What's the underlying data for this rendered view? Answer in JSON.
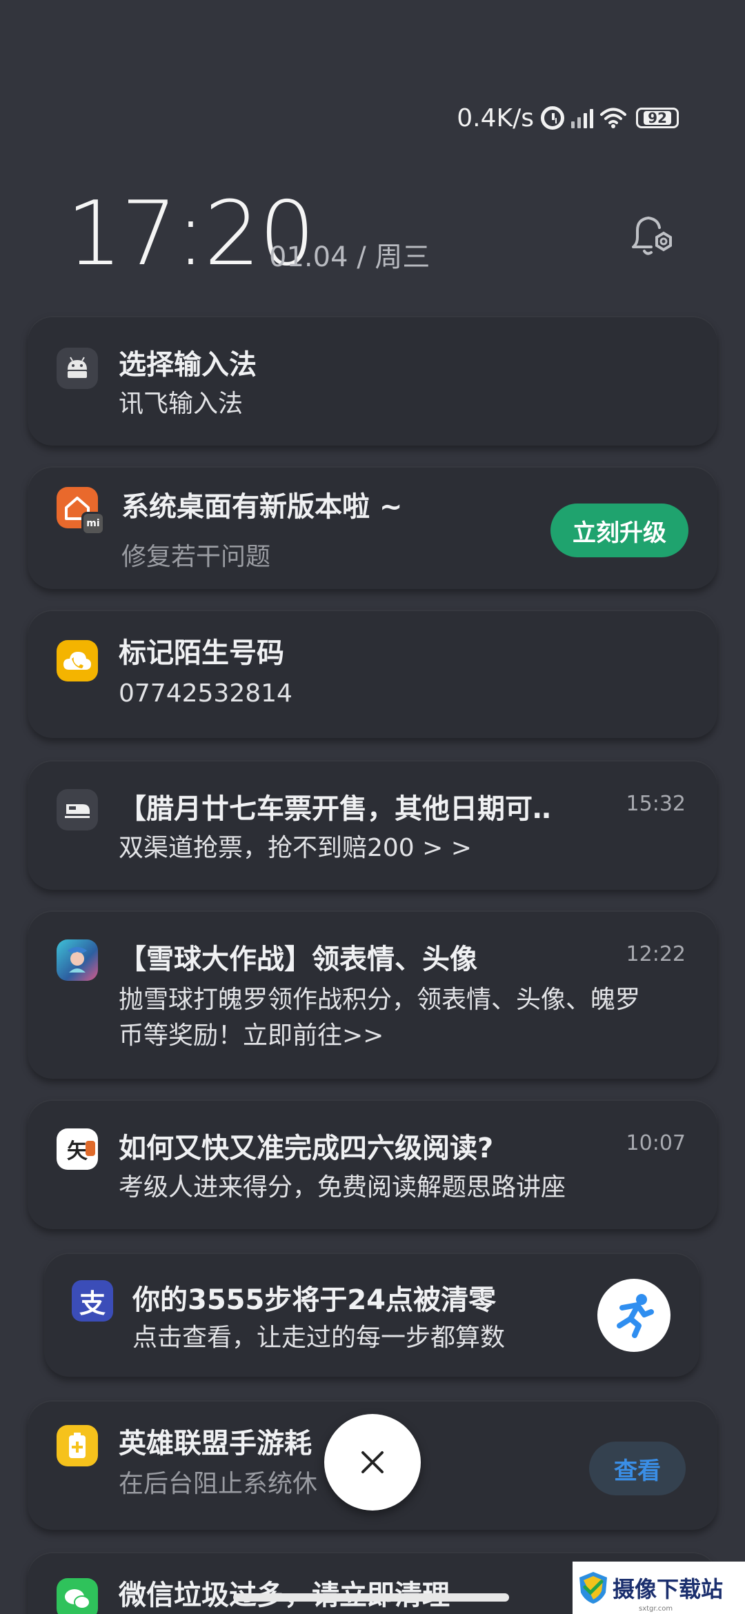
{
  "status_bar": {
    "net_speed": "0.4K/s",
    "battery": "92"
  },
  "lockscreen": {
    "time": "17:20",
    "date": "01.04 / 周三"
  },
  "notifications": [
    {
      "app": "android",
      "title": "选择输入法",
      "body": "讯飞输入法"
    },
    {
      "app": "system-launcher",
      "title": "系统桌面有新版本啦 ~",
      "body": "修复若干问题",
      "action": "立刻升级"
    },
    {
      "app": "phone-mark",
      "title": "标记陌生号码",
      "body": "07742532814"
    },
    {
      "app": "train-ticket",
      "title": "【腊月廿七车票开售，其他日期可‥",
      "body": "双渠道抢票，抢不到赔200 > >",
      "time": "15:32"
    },
    {
      "app": "game",
      "title": "【雪球大作战】领表情、头像",
      "body_line1": "抛雪球打魄罗领作战积分，领表情、头像、魄罗",
      "body_line2": "币等奖励！立即前往>>",
      "time": "12:22"
    },
    {
      "app": "reading",
      "title": "如何又快又准完成四六级阅读?",
      "body": "考级人进来得分，免费阅读解题思路讲座",
      "time": "10:07"
    },
    {
      "app": "alipay",
      "title": "你的3555步将于24点被清零",
      "body": "点击查看，让走过的每一步都算数"
    },
    {
      "app": "battery-saver",
      "title": "英雄联盟手游耗",
      "body": "在后台阻止系统休",
      "action": "查看"
    },
    {
      "app": "wechat",
      "title": "微信垃圾过多，请立即清理"
    }
  ],
  "watermark": {
    "text": "摄像下载站",
    "sub": "sxtgr.com"
  },
  "colors": {
    "background": "#33353d",
    "card": "#2c2e35",
    "upgrade_button": "#1fa36e",
    "view_button_text": "#3a8ee6"
  }
}
